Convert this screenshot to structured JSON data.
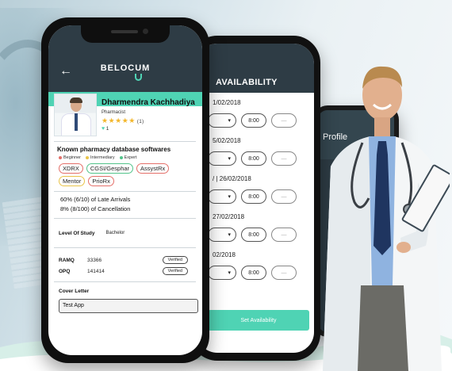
{
  "front_phone": {
    "app_name": "BELOCUM",
    "profile": {
      "name": "Dharmendra Kachhadiya",
      "role": "Pharmacist",
      "stars": "★★★★★",
      "rating_count": "(1)",
      "like_icon": "heart-icon",
      "likes": "1"
    },
    "skills": {
      "title": "Known pharmacy database softwares",
      "legend": [
        {
          "label": "Beginner",
          "color": "#e4706a"
        },
        {
          "label": "Intermediary",
          "color": "#e9c44b"
        },
        {
          "label": "Expert",
          "color": "#53c48b"
        }
      ],
      "tags": [
        {
          "label": "XDRX",
          "level": "red"
        },
        {
          "label": "CGSI/Gesphar",
          "level": "green"
        },
        {
          "label": "AssystRx",
          "level": "red"
        },
        {
          "label": "Mentor",
          "level": "yellow"
        },
        {
          "label": "PrioRx",
          "level": "red"
        }
      ]
    },
    "stats": {
      "late": "60% (6/10) of Late Arrivals",
      "cancel": "8% (8/100) of Cancellation"
    },
    "study": {
      "label": "Level Of Study",
      "value": "Bachelor"
    },
    "licenses": [
      {
        "key": "RAMQ",
        "value": "33366",
        "status": "Verified"
      },
      {
        "key": "OPQ",
        "value": "141414",
        "status": "Verified"
      }
    ],
    "cover_letter": {
      "label": "Cover Letter",
      "value": "Test App"
    }
  },
  "middle_phone": {
    "title": "AVAILABILITY",
    "rows": [
      {
        "date": "1/02/2018",
        "time": "8:00",
        "end": "—"
      },
      {
        "date": "5/02/2018",
        "time": "8:00",
        "end": "—"
      },
      {
        "date": "/ | 26/02/2018",
        "time": "8:00",
        "end": "—"
      },
      {
        "date": "27/02/2018",
        "time": "8:00",
        "end": "—"
      },
      {
        "date": "02/2018",
        "time": "8:00",
        "end": "—"
      }
    ],
    "button": "Set Availability"
  },
  "back_phone": {
    "title": "Profile"
  },
  "colors": {
    "accent": "#4fd3b4",
    "header": "#2e3c45",
    "star": "#f3b72c"
  }
}
